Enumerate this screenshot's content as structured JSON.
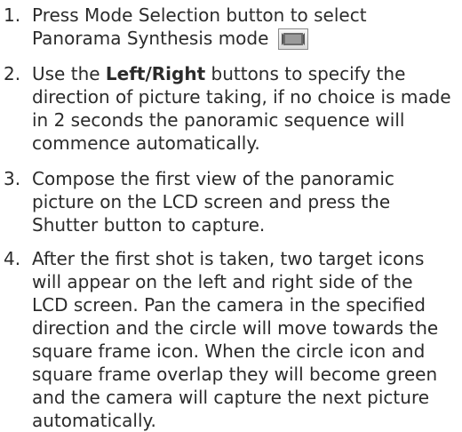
{
  "steps": [
    {
      "number": "1.",
      "text": "Press Mode Selection button to select Panorama Synthesis mode",
      "icon": "panorama-mode-icon"
    },
    {
      "number": "2.",
      "prefix": "Use the ",
      "bold": "Left/Right",
      "text": " buttons to specify the direction of picture taking, if no choice is made in 2 seconds the panoramic sequence will commence automatically."
    },
    {
      "number": "3.",
      "text": "Compose the first view of the panoramic picture on the LCD screen and press the Shutter button to capture."
    },
    {
      "number": "4.",
      "text": "After the first shot is taken, two target icons will appear on the left and right side of the LCD screen. Pan the camera in the specified direction and the circle will move towards the square frame icon.  When the circle icon and square frame overlap they will become green and the camera will capture the next picture automatically."
    }
  ]
}
